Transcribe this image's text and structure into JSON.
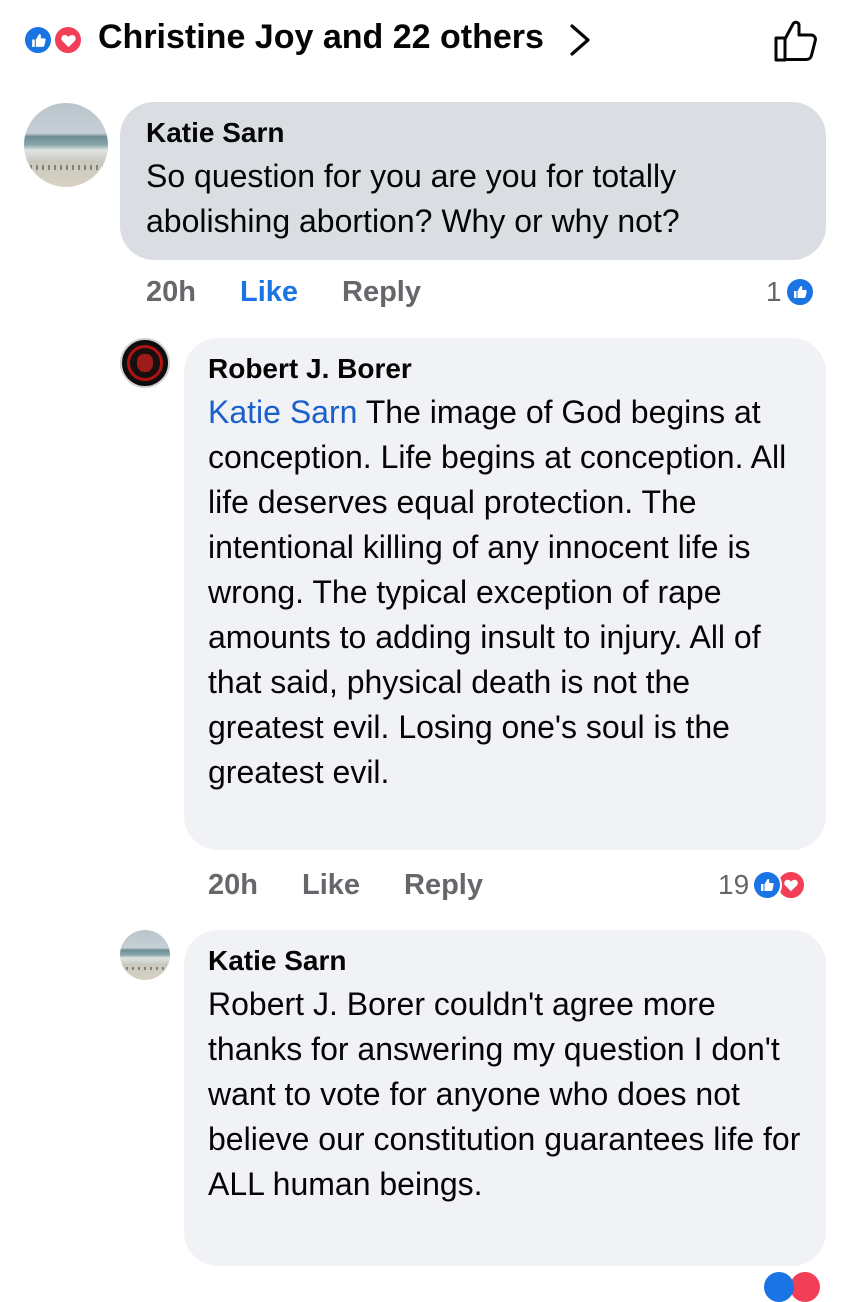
{
  "header": {
    "reactions": [
      "like",
      "love"
    ],
    "reactors_text": "Christine Joy and 22 others",
    "chevron_icon": "chevron-right-icon",
    "like_icon": "thumbs-up-outline-icon"
  },
  "colors": {
    "like_blue": "#1b74e4",
    "love_red": "#f33e58",
    "mention_blue": "#1b5fc9",
    "bubble_gray": "#dadde1",
    "bubble_light": "#f0f2f5",
    "meta_gray": "#65676b"
  },
  "comments": [
    {
      "author": "Katie Sarn",
      "avatar": "beach-photo-avatar",
      "mention": "",
      "text": "So question for you are you for totally abolishing abortion? Why or why not?",
      "time": "20h",
      "like_label": "Like",
      "liked": true,
      "reply_label": "Reply",
      "reaction_count": "1",
      "reactions": [
        "like"
      ]
    },
    {
      "author": "Robert J. Borer",
      "avatar": "dark-emblem-avatar",
      "mention": "Katie Sarn",
      "text": "The image of God begins at conception. Life begins at conception. All life deserves equal protection. The intentional killing of any innocent life is wrong. The typical exception of rape amounts to adding insult to injury. All of that said, physical death is not the greatest evil. Losing one's soul is the greatest evil.",
      "time": "20h",
      "like_label": "Like",
      "liked": false,
      "reply_label": "Reply",
      "reaction_count": "19",
      "reactions": [
        "like",
        "love"
      ]
    },
    {
      "author": "Katie Sarn",
      "avatar": "beach-photo-avatar",
      "mention": "",
      "text": "Robert J. Borer couldn't agree more thanks for answering my question I don't want to vote for anyone who does not believe our constitution guarantees life for ALL human beings.",
      "reactions": [
        "like",
        "love"
      ]
    }
  ]
}
